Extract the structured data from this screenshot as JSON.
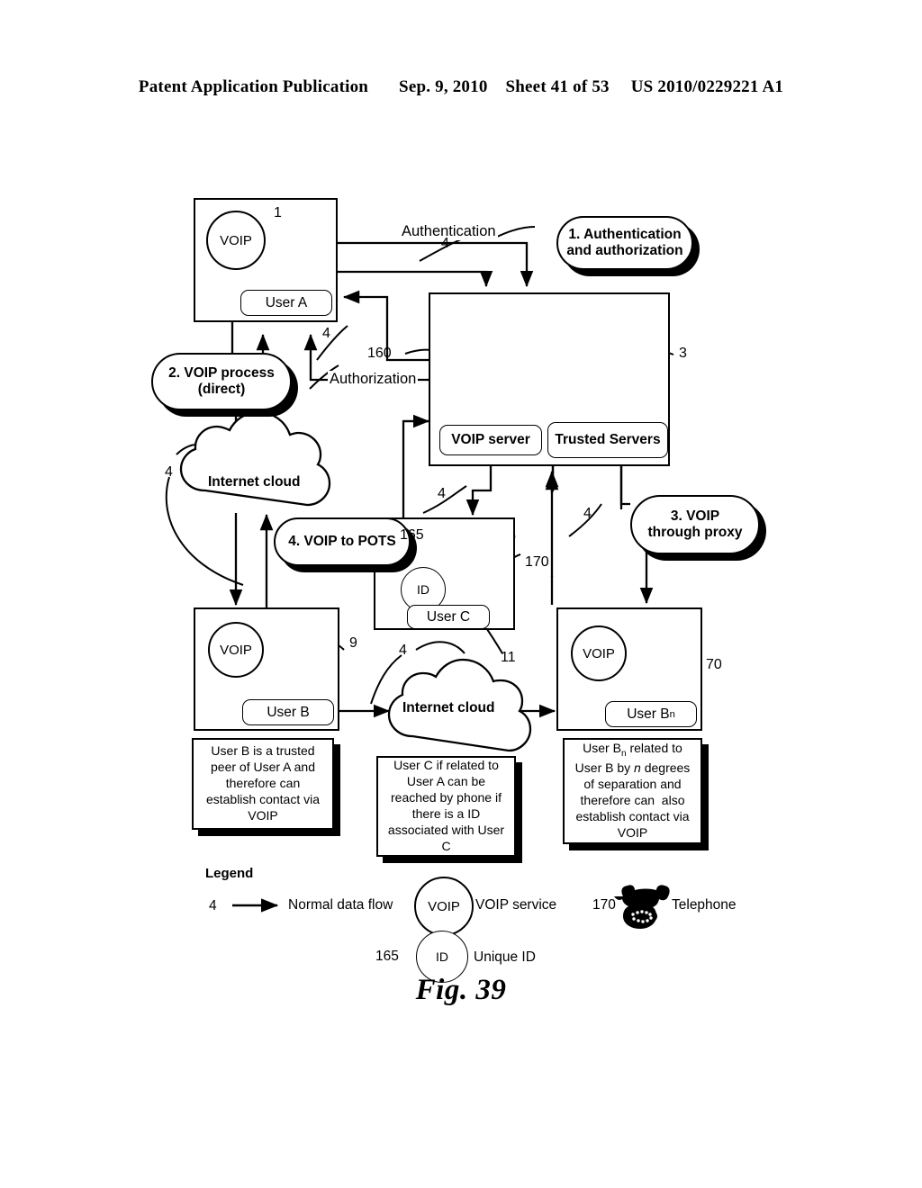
{
  "header": {
    "publication": "Patent Application Publication",
    "date": "Sep. 9, 2010",
    "sheet": "Sheet 41 of 53",
    "patent_number": "US 2010/0229221 A1"
  },
  "figure": {
    "caption": "Fig. 39"
  },
  "nodes": {
    "user_a": {
      "voip_label": "VOIP",
      "name_label": "User A",
      "ref": "1"
    },
    "user_b": {
      "voip_label": "VOIP",
      "name_label": "User B",
      "ref": "9"
    },
    "user_bn": {
      "voip_label": "VOIP",
      "name_label": "User B",
      "name_sub": "n",
      "ref": "70"
    },
    "user_c": {
      "id_label": "ID",
      "name_label": "User C",
      "id_ref": "165",
      "phone_ref": "170",
      "ref": "11"
    },
    "servers": {
      "voip_server_label": "VOIP server",
      "trusted_servers_label": "Trusted Servers",
      "voip_server_ref": "160",
      "trusted_servers_ref": "3"
    },
    "cloud_top": {
      "label": "Internet cloud"
    },
    "cloud_bottom": {
      "label": "Internet cloud"
    }
  },
  "callouts": {
    "step1": {
      "line1": "1.  Authentication",
      "line2": "and authorization"
    },
    "step2": {
      "line1": "2. VOIP  process",
      "line2": "(direct)"
    },
    "step3": {
      "line1": "3. VOIP",
      "line2": "through proxy"
    },
    "step4": {
      "line1": "4. VOIP to POTS"
    }
  },
  "edges": {
    "authentication": "Authentication",
    "authorization": "Authorization",
    "flow_ref": "4"
  },
  "notes": {
    "user_b_note": "User B is a trusted peer of User A and therefore can establish contact via VOIP",
    "user_c_note": "User C if related to User A can be reached by phone if there is a ID associated with User C",
    "user_bn_note": "User Bn related to User B by n degrees of separation and therefore can  also establish contact via VOIP"
  },
  "legend": {
    "title": "Legend",
    "items": [
      {
        "ref": "4",
        "label": "Normal data flow",
        "icon": "arrow-icon"
      },
      {
        "ref": "",
        "label": "VOIP  service",
        "icon": "voip-circle-icon",
        "icon_text": "VOIP"
      },
      {
        "ref": "165",
        "label": "Unique ID",
        "icon": "id-circle-icon",
        "icon_text": "ID"
      },
      {
        "ref": "170",
        "label": "Telephone",
        "icon": "telephone-icon"
      }
    ]
  }
}
